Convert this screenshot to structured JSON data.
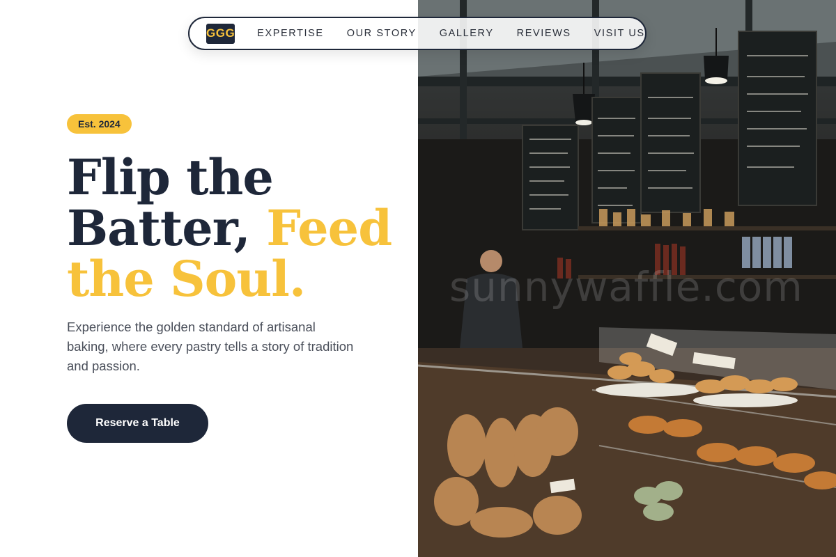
{
  "nav": {
    "logo": "GGG",
    "items": [
      {
        "label": "EXPERTISE"
      },
      {
        "label": "OUR STORY"
      },
      {
        "label": "GALLERY"
      },
      {
        "label": "REVIEWS"
      },
      {
        "label": "VISIT US"
      }
    ]
  },
  "hero": {
    "badge": "Est. 2024",
    "headline_line1": "Flip the",
    "headline_line2a": "Batter, ",
    "headline_line2b": "Feed",
    "headline_line3": "the Soul.",
    "description": "Experience the golden standard of artisanal baking, where every pastry tells a story of tradition and passion.",
    "cta_label": "Reserve a Table"
  },
  "photo": {
    "watermark": "sunnywaffle.com"
  },
  "colors": {
    "navy": "#1e2739",
    "gold": "#f7c23b",
    "body_text": "#4a4f5a"
  }
}
